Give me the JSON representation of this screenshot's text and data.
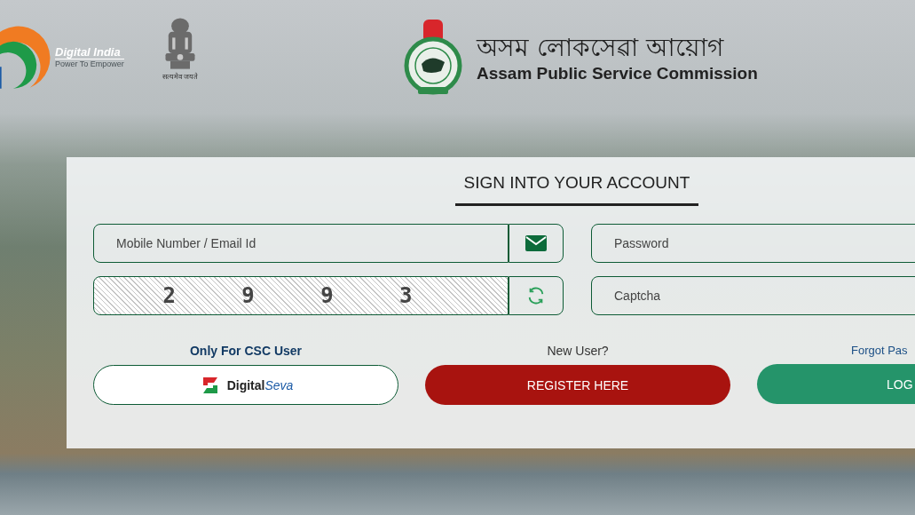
{
  "header": {
    "digital_india": {
      "title": "Digital India",
      "tagline": "Power To Empower"
    },
    "emblem_caption": "सत्यमेव जयते",
    "commission": {
      "name_assamese": "অসম লোকসেৱা আয়োগ",
      "name_english": "Assam Public Service Commission"
    }
  },
  "login": {
    "title": "SIGN INTO YOUR ACCOUNT",
    "fields": [
      {
        "kind": "email",
        "placeholder": "Mobile Number / Email Id"
      },
      {
        "kind": "password",
        "placeholder": "Password"
      },
      {
        "kind": "captcha_image",
        "text": "2 9 9 3"
      },
      {
        "kind": "captcha",
        "placeholder": "Captcha"
      }
    ],
    "actions": [
      {
        "kind": "csc",
        "caption": "Only For CSC User",
        "label": "Digital",
        "label_italic": "Seva"
      },
      {
        "kind": "register",
        "caption": "New User?",
        "label": "REGISTER HERE"
      },
      {
        "kind": "login",
        "caption": "Forgot Pas",
        "label": "LOG"
      }
    ]
  }
}
